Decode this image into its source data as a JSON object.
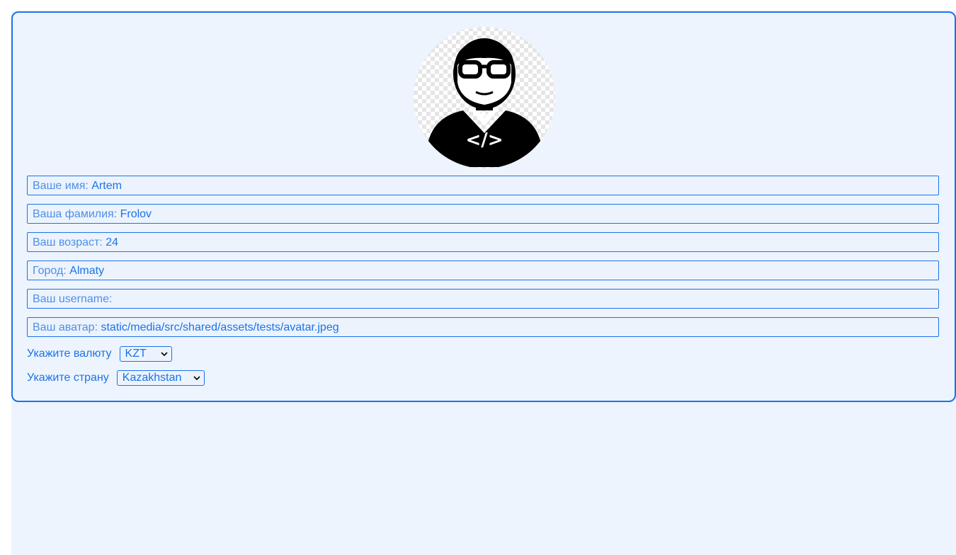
{
  "profile": {
    "avatar_icon": "developer-avatar-icon",
    "avatar_code_glyph": "</>",
    "fields": [
      {
        "label": "Ваше имя:",
        "value": "Artem"
      },
      {
        "label": "Ваша фамилия:",
        "value": "Frolov"
      },
      {
        "label": "Ваш возраст:",
        "value": "24"
      },
      {
        "label": "Город:",
        "value": "Almaty"
      },
      {
        "label": "Ваш username:",
        "value": ""
      },
      {
        "label": "Ваш аватар:",
        "value": "static/media/src/shared/assets/tests/avatar.jpeg"
      }
    ],
    "currency": {
      "label": "Укажите валюту",
      "selected": "KZT"
    },
    "country": {
      "label": "Укажите страну",
      "selected": "Kazakhstan"
    }
  },
  "colors": {
    "accent": "#1a73e8",
    "label": "#4d8fe8",
    "background": "#edf4fe"
  }
}
